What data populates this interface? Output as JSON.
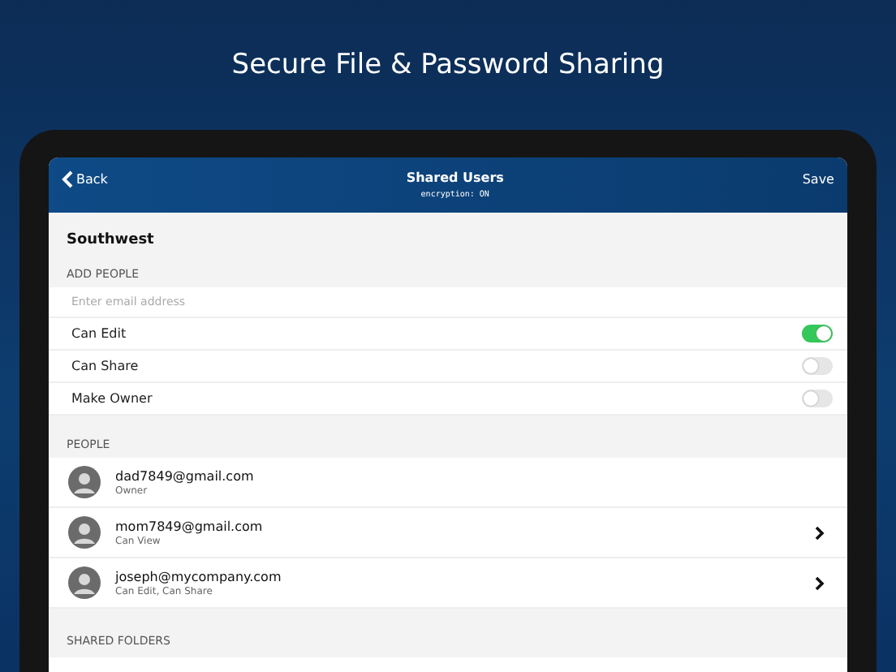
{
  "headline": "Secure File & Password Sharing",
  "nav": {
    "back": "Back",
    "title": "Shared Users",
    "subtitle": "encryption: ON",
    "action": "Save"
  },
  "item_name": "Southwest",
  "add_people": {
    "header": "ADD PEOPLE",
    "email": {
      "placeholder": "Enter email address"
    },
    "toggles": [
      {
        "label": "Can Edit",
        "on": true
      },
      {
        "label": "Can Share",
        "on": false
      },
      {
        "label": "Make Owner",
        "on": false
      }
    ]
  },
  "people": {
    "header": "PEOPLE",
    "items": [
      {
        "email": "dad7849@gmail.com",
        "role": "Owner",
        "disclosure": false
      },
      {
        "email": "mom7849@gmail.com",
        "role": "Can View",
        "disclosure": true
      },
      {
        "email": "joseph@mycompany.com",
        "role": "Can Edit, Can Share",
        "disclosure": true
      }
    ]
  },
  "shared_folders": {
    "header": "SHARED FOLDERS"
  }
}
